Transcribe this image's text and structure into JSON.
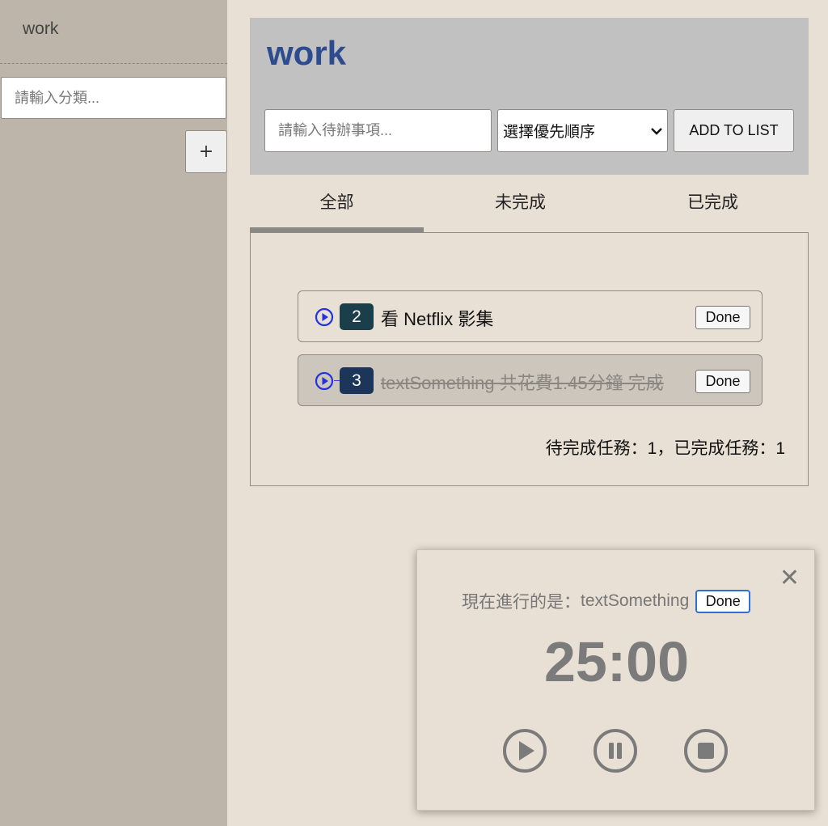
{
  "sidebar": {
    "categories": [
      "work"
    ],
    "input_placeholder": "請輸入分類...",
    "add_label": "+"
  },
  "header": {
    "title": "work",
    "todo_placeholder": "請輸入待辦事項...",
    "priority_selected": "選擇優先順序",
    "add_button": "ADD TO LIST"
  },
  "tabs": [
    {
      "label": "全部",
      "active": true
    },
    {
      "label": "未完成",
      "active": false
    },
    {
      "label": "已完成",
      "active": false
    }
  ],
  "todos": [
    {
      "priority": "2",
      "text": "看 Netflix 影集",
      "completed": false,
      "done_label": "Done"
    },
    {
      "priority": "3",
      "text": "textSomething 共花費1.45分鐘 完成",
      "completed": true,
      "done_label": "Done"
    }
  ],
  "counts_text": "待完成任務：1，已完成任務：1",
  "timer": {
    "now_prefix": "現在進行的是：",
    "now_task": "textSomething",
    "done_label": "Done",
    "time": "25:00",
    "close_icon": "close-icon",
    "controls": [
      "play-icon",
      "pause-icon",
      "stop-icon"
    ]
  },
  "colors": {
    "sidebar_bg": "#beb5aa",
    "page_bg": "#e8e0d4",
    "header_bg": "#c1c1c1",
    "title": "#2d4c8f",
    "play_icon": "#2233dd"
  }
}
